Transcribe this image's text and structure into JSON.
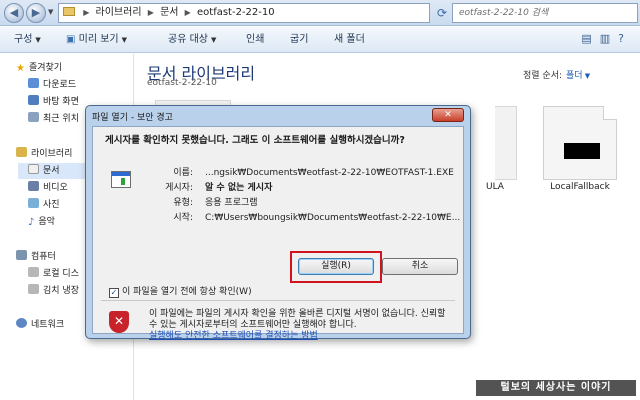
{
  "address": {
    "breadcrumb": [
      "라이브러리",
      "문서",
      "eotfast-2-22-10"
    ],
    "search_placeholder": "eotfast-2-22-10 검색"
  },
  "toolbar": {
    "organize": "구성",
    "preview": "미리 보기",
    "share": "공유 대상",
    "print": "인쇄",
    "burn": "굽기",
    "new_folder": "새 폴더"
  },
  "sidebar": {
    "favorites": "즐겨찾기",
    "downloads": "다운로드",
    "desktop": "바탕 화면",
    "recent": "최근 위치",
    "libraries": "라이브러리",
    "documents": "문서",
    "videos": "비디오",
    "pictures": "사진",
    "music": "음악",
    "computer": "컴퓨터",
    "local_disk": "로컬 디스",
    "kimchi": "김치 냉장",
    "network": "네트워크"
  },
  "main": {
    "library_title": "문서 라이브러리",
    "library_sub": "eotfast-2-22-10",
    "sort_label": "정렬 순서:",
    "sort_value": "폴더",
    "partial_label": "ULA",
    "file_label": "LocalFallback"
  },
  "dialog": {
    "title": "파일 열기 - 보안 경고",
    "heading": "게시자를 확인하지 못했습니다. 그래도 이 소프트웨어를 실행하시겠습니까?",
    "labels": {
      "name": "이름:",
      "publisher": "게시자:",
      "type": "유형:",
      "from": "시작:"
    },
    "values": {
      "name": "...ngsik₩Documents₩eotfast-2-22-10₩EOTFAST-1.EXE",
      "publisher": "알 수 없는 게시자",
      "type": "응용 프로그램",
      "from": "C:₩Users₩boungsik₩Documents₩eotfast-2-22-10₩E..."
    },
    "run_button": "실행(R)",
    "cancel_button": "취소",
    "checkbox_label": "이 파일을 열기 전에 항상 확인(W)",
    "warning_text": "이 파일에는 파일의 게시자 확인을 위한 올바른 디지털 서명이 없습니다. 신뢰할 수 있는 게시자로부터의 소프트웨어만 실행해야 합니다.",
    "warning_link": "실행해도 안전한 소프트웨어를 결정하는 방법"
  },
  "watermark": "털보의 세상사는 이야기",
  "colors": {
    "highlight_box": "#d0141e",
    "link": "#1e4fb5",
    "library_title": "#1e3a78"
  }
}
